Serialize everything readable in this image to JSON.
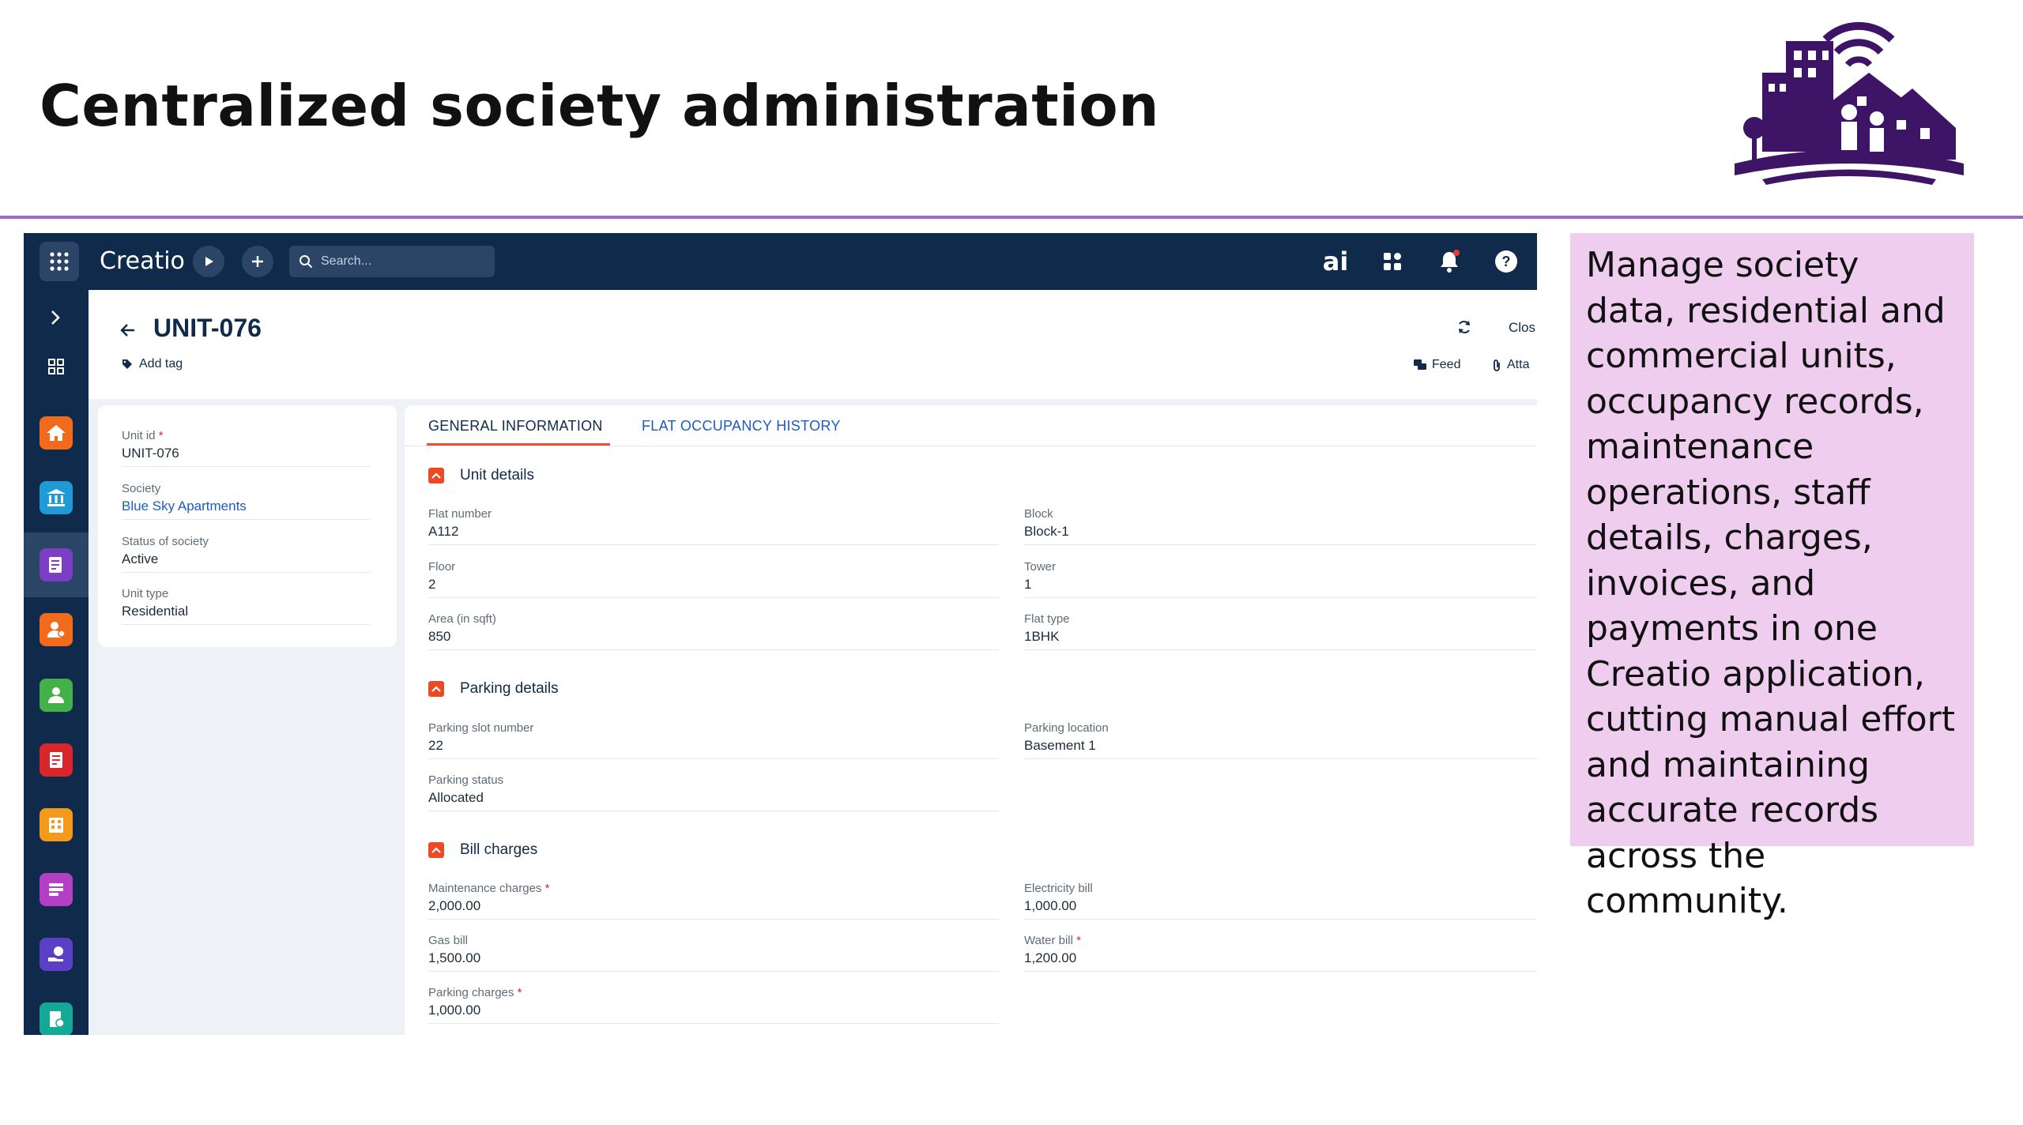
{
  "slide": {
    "title": "Centralized society administration",
    "description": "Manage society data, residential and commercial units, occupancy records, maintenance operations, staff details, charges, invoices, and payments in one Creatio application, cutting manual effort and maintaining accurate records across the community."
  },
  "colors": {
    "nav_bg": "#0f2a4a",
    "accent": "#ec4a24",
    "link": "#1b5cc2",
    "divider": "#9b6bc7",
    "info_box": "#efcdee"
  },
  "topbar": {
    "logo": "Creatio",
    "search_placeholder": "Search...",
    "ai_label": "ai",
    "icons": [
      "apps-grid-icon",
      "play-icon",
      "plus-icon",
      "search-icon",
      "ai-icon",
      "app-tiles-icon",
      "bell-icon",
      "help-icon"
    ]
  },
  "rail": {
    "items": [
      {
        "name": "home",
        "icon": "home-icon",
        "color": "#f26a1b"
      },
      {
        "name": "society",
        "icon": "bank-icon",
        "color": "#1e9bd7"
      },
      {
        "name": "units",
        "icon": "unit-icon",
        "color": "#7b3fc4"
      },
      {
        "name": "staff",
        "icon": "staff-icon",
        "color": "#f26a1b"
      },
      {
        "name": "residents",
        "icon": "person-icon",
        "color": "#43b04a"
      },
      {
        "name": "invoices",
        "icon": "invoice-icon",
        "color": "#d9262b"
      },
      {
        "name": "buildings",
        "icon": "building-icon",
        "color": "#f39a1b"
      },
      {
        "name": "charges",
        "icon": "list-icon",
        "color": "#b23fc4"
      },
      {
        "name": "payments",
        "icon": "payment-icon",
        "color": "#5b3fc4"
      },
      {
        "name": "reports",
        "icon": "report-icon",
        "color": "#14a896"
      }
    ]
  },
  "header": {
    "title": "UNIT-076",
    "add_tag": "Add tag",
    "close": "Clos",
    "feed": "Feed",
    "attachments": "Atta"
  },
  "summary": {
    "unit_id_label": "Unit id",
    "unit_id": "UNIT-076",
    "society_label": "Society",
    "society": "Blue Sky Apartments",
    "status_label": "Status of society",
    "status": "Active",
    "type_label": "Unit type",
    "type": "Residential"
  },
  "tabs": {
    "general": "GENERAL INFORMATION",
    "history": "FLAT OCCUPANCY HISTORY"
  },
  "unit_details": {
    "title": "Unit details",
    "flat_number_label": "Flat number",
    "flat_number": "A112",
    "block_label": "Block",
    "block": "Block-1",
    "floor_label": "Floor",
    "floor": "2",
    "tower_label": "Tower",
    "tower": "1",
    "area_label": "Area (in sqft)",
    "area": "850",
    "flat_type_label": "Flat type",
    "flat_type": "1BHK"
  },
  "parking": {
    "title": "Parking details",
    "slot_label": "Parking slot number",
    "slot": "22",
    "location_label": "Parking location",
    "location": "Basement 1",
    "status_label": "Parking status",
    "status": "Allocated"
  },
  "bills": {
    "title": "Bill charges",
    "maintenance_label": "Maintenance charges",
    "maintenance": "2,000.00",
    "electricity_label": "Electricity bill",
    "electricity": "1,000.00",
    "gas_label": "Gas bill",
    "gas": "1,500.00",
    "water_label": "Water bill",
    "water": "1,200.00",
    "parking_label": "Parking charges",
    "parking": "1,000.00"
  }
}
